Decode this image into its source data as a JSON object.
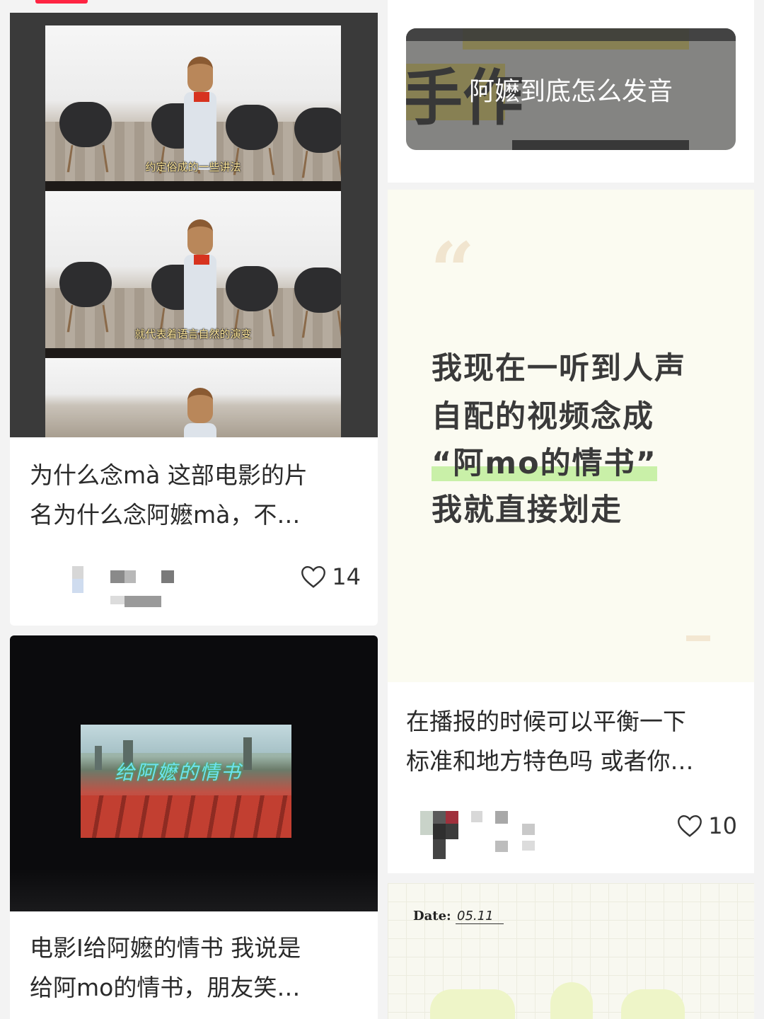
{
  "feed": {
    "left_column": [
      {
        "title": "为什么念mà 这部电影的片名为什么念阿嬷mà，不…",
        "title_line1": "为什么念mà 这部电影的片",
        "title_line2": "名为什么念阿嬷mà，不…",
        "likes": "14",
        "image_subtitles": [
          "约定俗成的一些讲法",
          "就代表着语言自然的演变"
        ]
      },
      {
        "title": "电影I给阿嬷的情书 我说是给阿mo的情书，朋友笑…",
        "title_line1": "电影I给阿嬷的情书 我说是",
        "title_line2": "给阿mo的情书，朋友笑…",
        "image_text": "给阿嬷的情书"
      }
    ],
    "right_column": [
      {
        "image_caption": "阿嬷到底怎么发音",
        "image_bg_text": [
          "手作"
        ]
      },
      {
        "quote_mark": "“",
        "quote_lines": [
          "我现在一听到人声",
          "自配的视频念成",
          "“阿mo的情书”",
          "我就直接划走"
        ],
        "title": "在播报的时候可以平衡一下标准和地方特色吗 或者你…",
        "title_line1": "在播报的时候可以平衡一下",
        "title_line2": "标准和地方特色吗 或者你…",
        "likes": "10"
      },
      {
        "date_label": "Date:",
        "date_value": "05.11"
      }
    ]
  },
  "colors": {
    "accent": "#ff2442",
    "highlight_green": "#c9f0a8",
    "highlight_yellow": "#f1e06a"
  },
  "icons": {
    "like": "heart-outline-icon",
    "quote": "quote-mark-icon"
  }
}
